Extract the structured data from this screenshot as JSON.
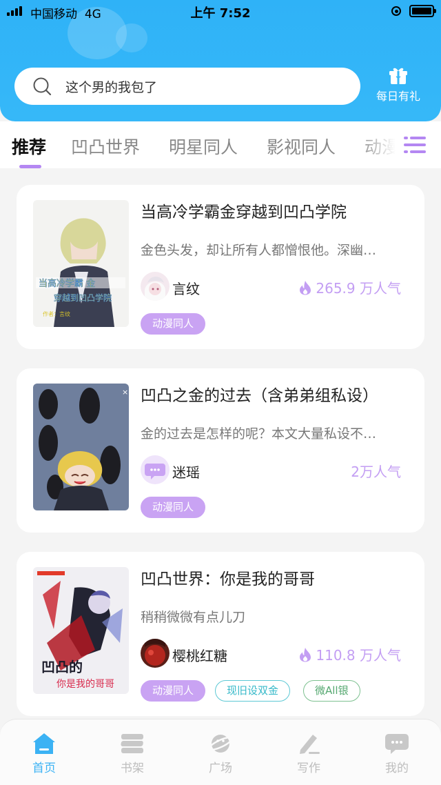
{
  "status_bar": {
    "carrier": "中国移动",
    "network": "4G",
    "time": "上午 7:52"
  },
  "search": {
    "placeholder": "这个男的我包了"
  },
  "daily_gift": {
    "label": "每日有礼"
  },
  "tabs": [
    {
      "label": "推荐",
      "active": true
    },
    {
      "label": "凹凸世界"
    },
    {
      "label": "明星同人"
    },
    {
      "label": "影视同人"
    },
    {
      "label": "动漫"
    }
  ],
  "colors": {
    "header": "#36b8f8",
    "accent": "#b487f2",
    "tag_purple": "#c9a3f3",
    "nav_active": "#3bb2f4"
  },
  "stories": [
    {
      "title": "当高冷学霸金穿越到凹凸学院",
      "summary": "金色头发，却让所有人都憎恨他。深幽…",
      "author": "言纹",
      "popularity": "265.9 万人气",
      "hot": true,
      "tags": [
        "动漫同人"
      ]
    },
    {
      "title": "凹凸之金的过去（含弟弟组私设）",
      "summary": "金的过去是怎样的呢？本文大量私设不…",
      "author": "迷瑶",
      "popularity": "2万人气",
      "hot": false,
      "tags": [
        "动漫同人"
      ]
    },
    {
      "title": "凹凸世界：你是我的哥哥",
      "summary": "稍稍微微有点儿刀",
      "author": "樱桃红糖",
      "popularity": "110.8 万人气",
      "hot": true,
      "tags": [
        "动漫同人",
        "现旧设双金",
        "微All银"
      ]
    }
  ],
  "bottom_nav": [
    {
      "label": "首页",
      "icon": "home-icon",
      "active": true
    },
    {
      "label": "书架",
      "icon": "bookshelf-icon"
    },
    {
      "label": "广场",
      "icon": "planet-icon"
    },
    {
      "label": "写作",
      "icon": "pen-icon"
    },
    {
      "label": "我的",
      "icon": "chat-bubble-icon"
    }
  ]
}
